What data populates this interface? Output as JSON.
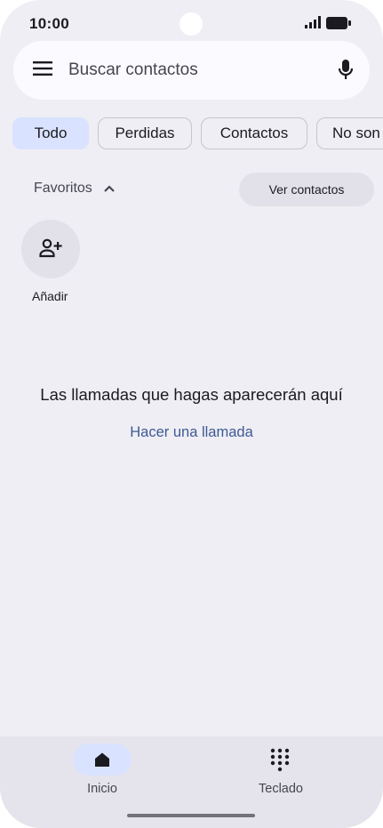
{
  "status_bar": {
    "time": "10:00"
  },
  "search": {
    "placeholder": "Buscar contactos"
  },
  "filters": [
    "Todo",
    "Perdidas",
    "Contactos",
    "No son"
  ],
  "favorites": {
    "label": "Favoritos",
    "view_contacts_label": "Ver contactos",
    "add_label": "Añadir"
  },
  "empty_state": {
    "message": "Las llamadas que hagas aparecerán aquí",
    "action_label": "Hacer una llamada"
  },
  "bottom_nav": {
    "home_label": "Inicio",
    "dialpad_label": "Teclado"
  },
  "colors": {
    "background": "#efeef4",
    "accent": "#d9e2ff",
    "link": "#3e5a94"
  }
}
